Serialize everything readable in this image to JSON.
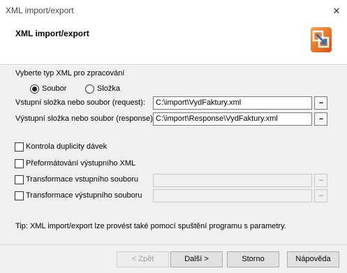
{
  "window": {
    "title": "XML import/export",
    "close_icon": "close-icon"
  },
  "header": {
    "heading": "XML import/export",
    "logo_icon": "import-export-logo"
  },
  "type_section": {
    "label": "Vyberte typ XML pro zpracování",
    "options": [
      {
        "label": "Soubor",
        "checked": true
      },
      {
        "label": "Složka",
        "checked": false
      }
    ]
  },
  "input_path": {
    "label": "Vstupní složka nebo soubor (request):",
    "value": "C:\\import\\VydFaktury.xml",
    "browse": "..."
  },
  "output_path": {
    "label": "Výstupní složka nebo soubor (response):",
    "value": "C:\\import\\Response\\VydFaktury.xml",
    "browse": "..."
  },
  "checks": [
    {
      "label": "Kontrola duplicity dávek",
      "checked": false
    },
    {
      "label": "Přeformátování výstupního XML",
      "checked": false
    },
    {
      "label": "Transformace vstupního souboru",
      "checked": false
    },
    {
      "label": "Transformace výstupního souboru",
      "checked": false
    }
  ],
  "transform_browse": "...",
  "tip": "Tip: XML import/export lze provést také pomocí spuštění programu s parametry.",
  "buttons": {
    "back": "< Zpět",
    "next": "Další >",
    "cancel": "Storno",
    "help": "Nápověda"
  },
  "colors": {
    "accent_orange": "#e8641a",
    "accent_blue": "#2b6cc4"
  }
}
